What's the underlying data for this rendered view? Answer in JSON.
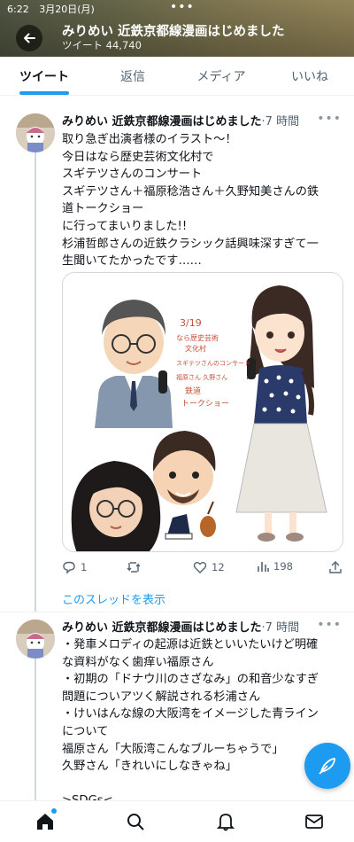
{
  "status_bar": {
    "time": "6:22",
    "date": "3月20日(月)"
  },
  "header": {
    "title": "みりめい 近鉄京都線漫画はじめました",
    "subtitle": "ツイート 44,740"
  },
  "tabs": [
    {
      "label": "ツイート",
      "active": true
    },
    {
      "label": "返信",
      "active": false
    },
    {
      "label": "メディア",
      "active": false
    },
    {
      "label": "いいね",
      "active": false
    }
  ],
  "tweet1": {
    "name": "みりめい 近鉄京都線漫画はじめました",
    "time": "·7 時間",
    "lines": [
      "取り急ぎ出演者様のイラスト～！",
      "今日はなら歴史芸術文化村で",
      "スギテツさんのコンサート",
      "スギテツさん＋福原稔浩さん＋久野知美さんの鉄",
      "道トークショー",
      "に行ってまいりました!!",
      "杉浦哲郎さんの近鉄クラシック話興味深すぎて一",
      "生聞いてたかったです……"
    ],
    "illustration_text": [
      "3/19",
      "なら歴史芸術",
      "文化村",
      "スギテツさんのコンサート",
      "福原さん 久野さん",
      "鉄道",
      "トークショー"
    ],
    "stats": {
      "replies": "1",
      "likes": "12",
      "views": "198"
    }
  },
  "show_thread": "このスレッドを表示",
  "tweet2": {
    "name": "みりめい 近鉄京都線漫画はじめました",
    "time": "·7 時間",
    "lines": [
      "・発車メロディの起源は近鉄といいたいけど明確",
      "な資料がなく歯痒い福原さん",
      "・初期の「ドナウ川のさざなみ」の和音少なすぎ",
      "問題についアツく解説される杉浦さん",
      "・けいはんな線の大阪湾をイメージした青ライン",
      "について",
      "福原さん「大阪湾こんなブルーちゃうで」",
      "久野さん「きれいにしなきゃね」",
      "",
      ">SDGs<"
    ]
  },
  "icons": [
    "back-arrow-icon",
    "more-icon",
    "reply-icon",
    "retweet-icon",
    "like-icon",
    "views-icon",
    "share-icon",
    "compose-icon",
    "home-icon",
    "search-icon",
    "notifications-icon",
    "messages-icon"
  ],
  "colors": {
    "accent": "#1d9bf0",
    "text": "#0f1419",
    "muted": "#536471"
  }
}
